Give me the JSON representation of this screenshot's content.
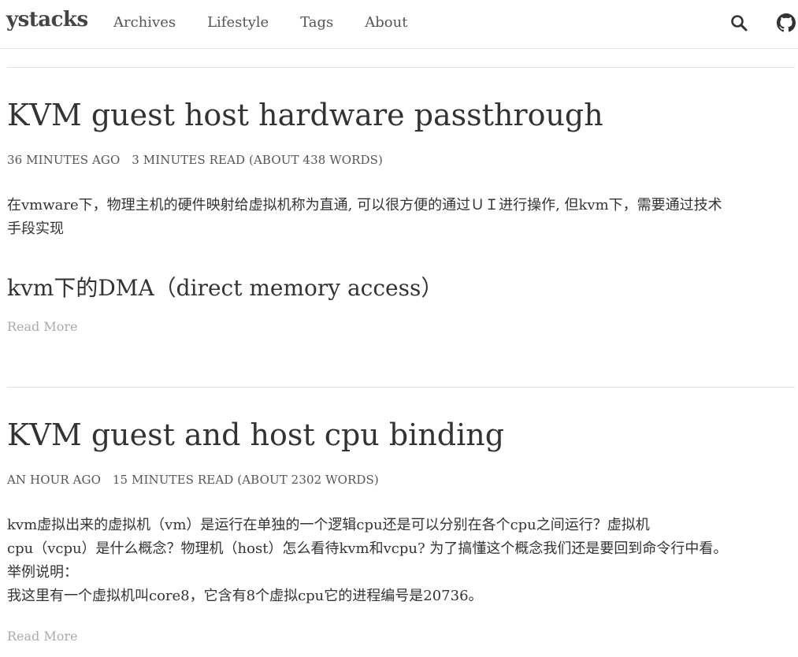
{
  "header": {
    "brand": "ystacks",
    "nav": [
      "Archives",
      "Lifestyle",
      "Tags",
      "About"
    ],
    "icons": [
      "search-icon",
      "github-icon"
    ]
  },
  "posts": [
    {
      "title": "KVM guest host hardware passthrough",
      "meta": {
        "time": "36 MINUTES AGO",
        "read": "3 MINUTES READ (ABOUT 438 WORDS)"
      },
      "excerpt_lines": [
        "在vmware下，物理主机的硬件映射给虚拟机称为直通, 可以很方便的通过ＵＩ进行操作, 但kvm下，需要通过技术",
        "手段实现"
      ],
      "subheading": "kvm下的DMA（direct memory access）",
      "read_more": "Read More"
    },
    {
      "title": "KVM guest and host cpu binding",
      "meta": {
        "time": "AN HOUR AGO",
        "read": "15 MINUTES READ (ABOUT 2302 WORDS)"
      },
      "excerpt_lines": [
        "kvm虚拟出来的虚拟机（vm）是运行在单独的一个逻辑cpu还是可以分别在各个cpu之间运行？虚拟机",
        "cpu（vcpu）是什么概念？物理机（host）怎么看待kvm和vcpu? 为了搞懂这个概念我们还是要回到命令行中看。",
        "举例说明：",
        "我这里有一个虚拟机叫core8，它含有8个虚拟cpu它的进程编号是20736。"
      ],
      "read_more": "Read More"
    }
  ],
  "colors": {
    "text": "#333333",
    "muted": "#aaaaaa",
    "border": "#e2e2e2"
  }
}
